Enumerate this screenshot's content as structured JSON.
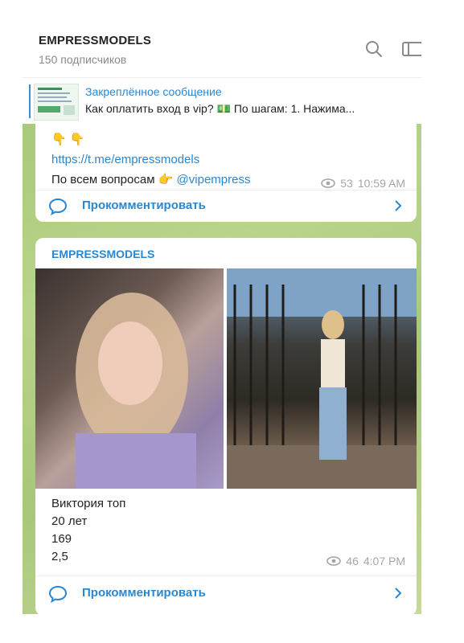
{
  "header": {
    "title": "EMPRESSMODELS",
    "subtitle": "150 подписчиков",
    "search_icon": "search-icon",
    "sidebar_icon": "panel-icon"
  },
  "pinned": {
    "title": "Закреплённое сообщение",
    "text": "Как оплатить вход в vip? 💵 По шагам:  1. Нажима..."
  },
  "messages": [
    {
      "emoji": "👇👇",
      "link": "https://t.me/empressmodels",
      "text_prefix": "По всем вопросам 👉",
      "mention": "@vipempress",
      "views": "53",
      "time": "10:59 AM",
      "comment_label": "Прокомментировать"
    },
    {
      "sender": "EMPRESSMODELS",
      "caption": [
        "Виктория топ",
        "20 лет",
        "169",
        "2,5"
      ],
      "views": "46",
      "time": "4:07 PM",
      "comment_label": "Прокомментировать"
    }
  ],
  "colors": {
    "accent": "#2b87d0",
    "chat_bg": "#a9c97b",
    "meta_text": "#a6a6a6"
  }
}
